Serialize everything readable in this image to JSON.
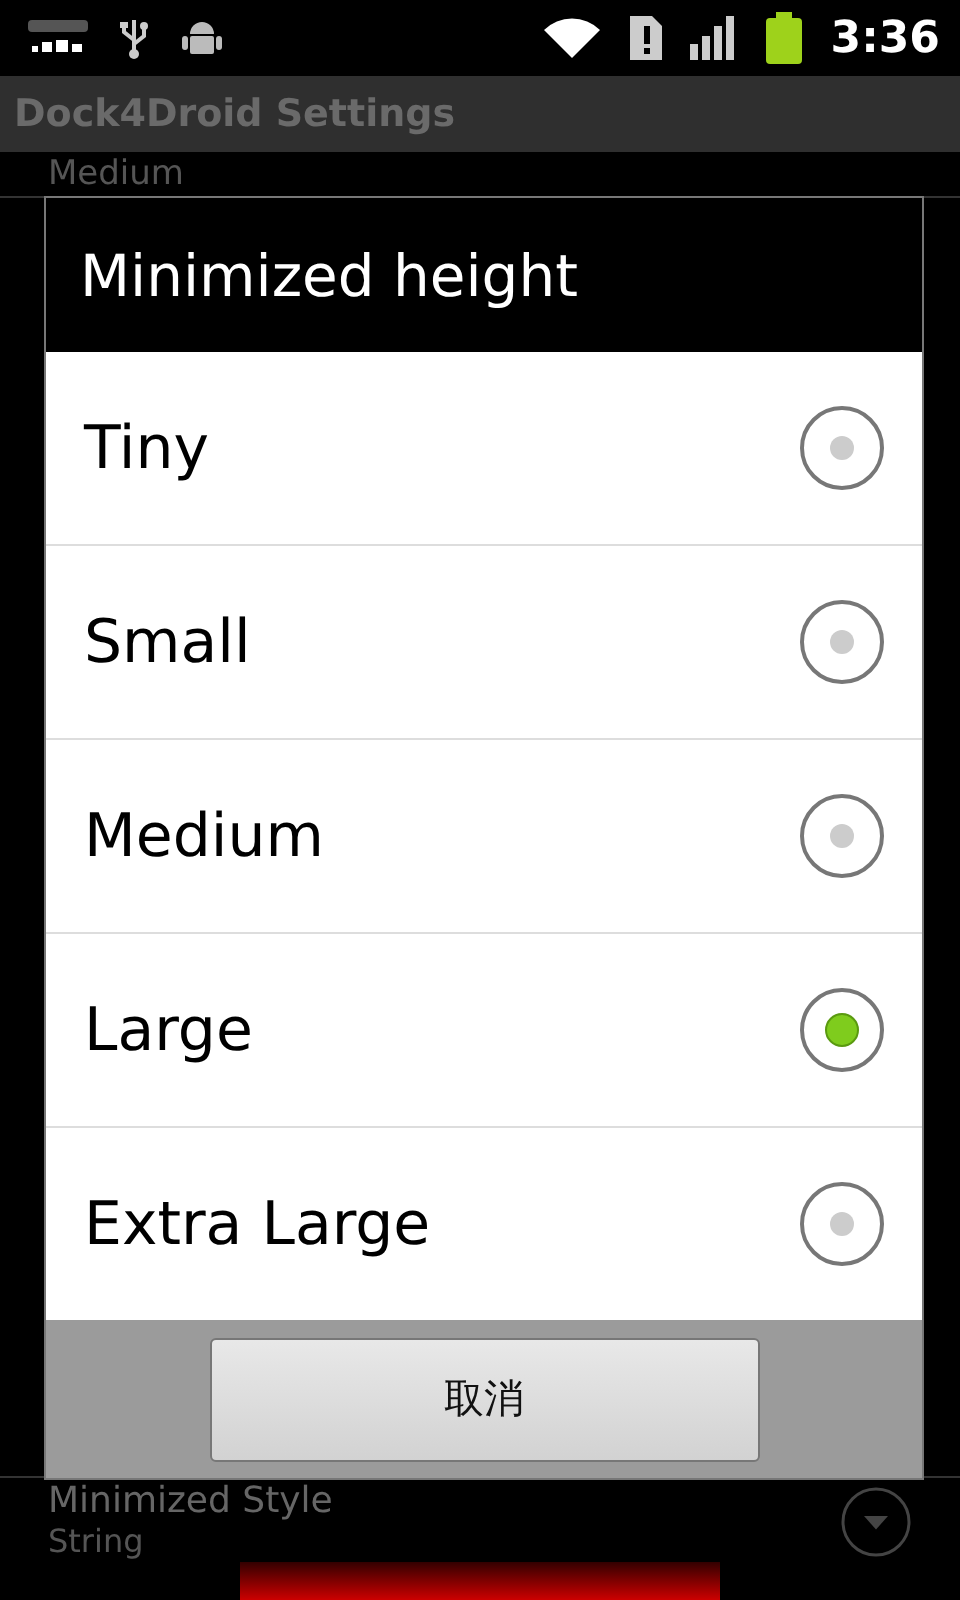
{
  "status_bar": {
    "time": "3:36"
  },
  "app_bar": {
    "title": "Dock4Droid Settings"
  },
  "background_items": [
    {
      "summary": "Medium"
    },
    {
      "title": "Minimized Style",
      "summary": "String"
    }
  ],
  "dialog": {
    "title": "Minimized height",
    "options": [
      {
        "label": "Tiny",
        "selected": false
      },
      {
        "label": "Small",
        "selected": false
      },
      {
        "label": "Medium",
        "selected": false
      },
      {
        "label": "Large",
        "selected": true
      },
      {
        "label": "Extra Large",
        "selected": false
      }
    ],
    "cancel_button": "取消"
  }
}
